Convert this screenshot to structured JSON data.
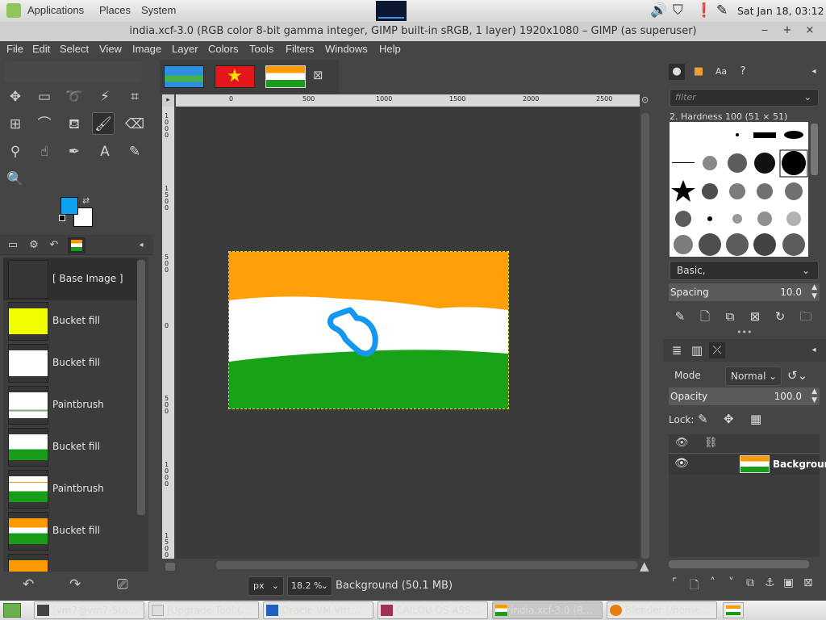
{
  "top_panel": {
    "menus": [
      "Applications",
      "Places",
      "System"
    ],
    "clock": "Sat Jan 18, 03:12"
  },
  "window": {
    "title": "india.xcf-3.0 (RGB color 8-bit gamma integer, GIMP built-in sRGB, 1 layer) 1920x1080 – GIMP (as superuser)",
    "buttons": [
      "‒",
      "+",
      "×"
    ]
  },
  "menubar": [
    "File",
    "Edit",
    "Select",
    "View",
    "Image",
    "Layer",
    "Colors",
    "Tools",
    "Filters",
    "Windows",
    "Help"
  ],
  "toolbox": {
    "foreground_color": "#0fa1f2",
    "background_color": "#ffffff",
    "icons": [
      "move-icon",
      "rect-select-icon",
      "lasso-icon",
      "fuzzy-select-icon",
      "crop-icon",
      "transform-icon",
      "warp-icon",
      "bucket-fill-icon",
      "paintbrush-icon",
      "eraser-icon",
      "clone-icon",
      "smudge-icon",
      "paths-icon",
      "text-icon",
      "color-picker-icon",
      "zoom-icon"
    ]
  },
  "undo_history": {
    "items": [
      {
        "label": "[ Base Image ]"
      },
      {
        "label": "Bucket fill"
      },
      {
        "label": "Bucket fill"
      },
      {
        "label": "Paintbrush"
      },
      {
        "label": "Bucket fill"
      },
      {
        "label": "Paintbrush"
      },
      {
        "label": "Bucket fill"
      }
    ]
  },
  "ruler": {
    "top_ticks": [
      "0",
      "500",
      "1000",
      "1500",
      "2000",
      "2500"
    ],
    "left_ticks": [
      "1000",
      "1500",
      "500",
      "0",
      "500",
      "1000",
      "1500",
      "2000"
    ]
  },
  "status": {
    "unit": "px",
    "zoom": "18.2 %",
    "text": "Background (50.1 MB)"
  },
  "brushes": {
    "filter_placeholder": "filter",
    "selected_title": "2. Hardness 100 (51 × 51)",
    "preset": "Basic,",
    "spacing_label": "Spacing",
    "spacing_value": "10.0"
  },
  "layers": {
    "mode_label": "Mode",
    "mode_value": "Normal",
    "opacity_label": "Opacity",
    "opacity_value": "100.0",
    "lock_label": "Lock:",
    "layer_name": "Backgroun"
  },
  "taskbar": {
    "tasks": [
      {
        "label": "[vm7@vm7-Sta..."
      },
      {
        "label": "[Upgrade Tool (..."
      },
      {
        "label": "Oracle VM Virt..."
      },
      {
        "label": "CAILOU OS ASS..."
      },
      {
        "label": "india.xcf-3.0 (R..."
      },
      {
        "label": "Blender [/home..."
      }
    ]
  }
}
